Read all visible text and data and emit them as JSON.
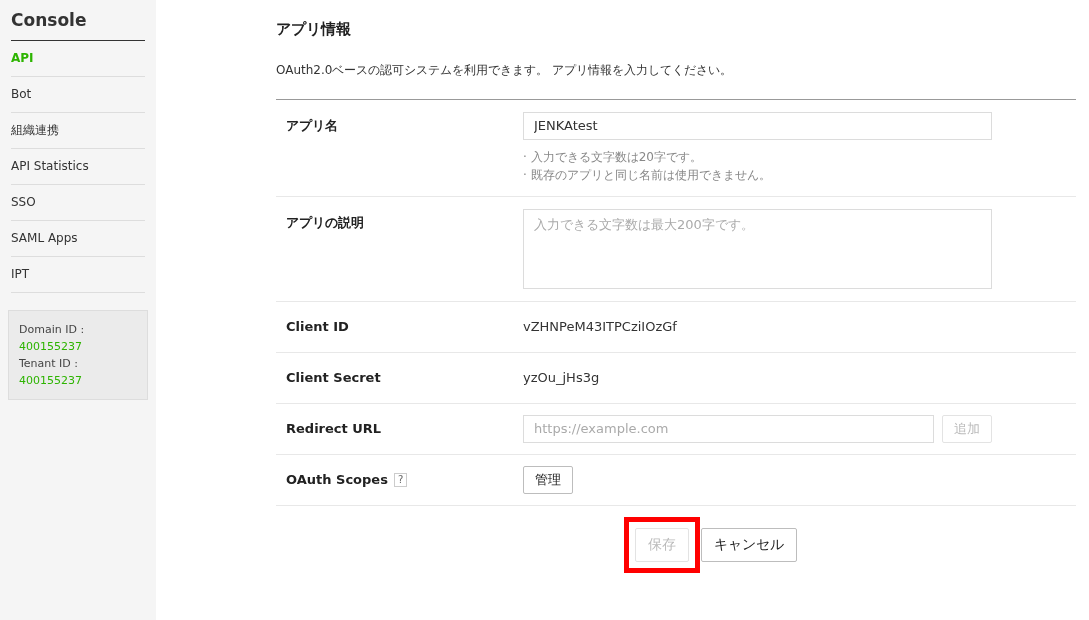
{
  "sidebar": {
    "title": "Console",
    "items": [
      {
        "label": "API",
        "selected": true
      },
      {
        "label": "Bot",
        "selected": false
      },
      {
        "label": "組織連携",
        "selected": false
      },
      {
        "label": "API Statistics",
        "selected": false
      },
      {
        "label": "SSO",
        "selected": false
      },
      {
        "label": "SAML Apps",
        "selected": false
      },
      {
        "label": "IPT",
        "selected": false
      }
    ],
    "info": [
      {
        "label": "Domain ID :",
        "value": "400155237"
      },
      {
        "label": "Tenant ID :",
        "value": "400155237"
      }
    ]
  },
  "heading": "アプリ情報",
  "description": "OAuth2.0ベースの認可システムを利用できます。 アプリ情報を入力してください。",
  "rows": [
    {
      "kind": "input",
      "label": "アプリ名",
      "value": "JENKAtest",
      "notes": [
        "· 入力できる文字数は20字です。",
        "· 既存のアプリと同じ名前は使用できません。"
      ]
    },
    {
      "kind": "textarea",
      "label": "アプリの説明",
      "placeholder": "入力できる文字数は最大200字です。"
    },
    {
      "kind": "text",
      "label": "Client ID",
      "value": "vZHNPeM43ITPCziIOzGf"
    },
    {
      "kind": "text",
      "label": "Client Secret",
      "value": "yzOu_jHs3g"
    },
    {
      "kind": "url",
      "label": "Redirect URL",
      "placeholder": "https://example.com",
      "button": {
        "label": "追加",
        "disabled": true
      }
    },
    {
      "kind": "button",
      "label": "OAuth Scopes",
      "help": "?",
      "button": {
        "label": "管理",
        "disabled": false
      }
    }
  ],
  "actions": [
    {
      "label": "保存",
      "disabled": true,
      "highlighted": true
    },
    {
      "label": "キャンセル",
      "disabled": false,
      "highlighted": false
    }
  ]
}
